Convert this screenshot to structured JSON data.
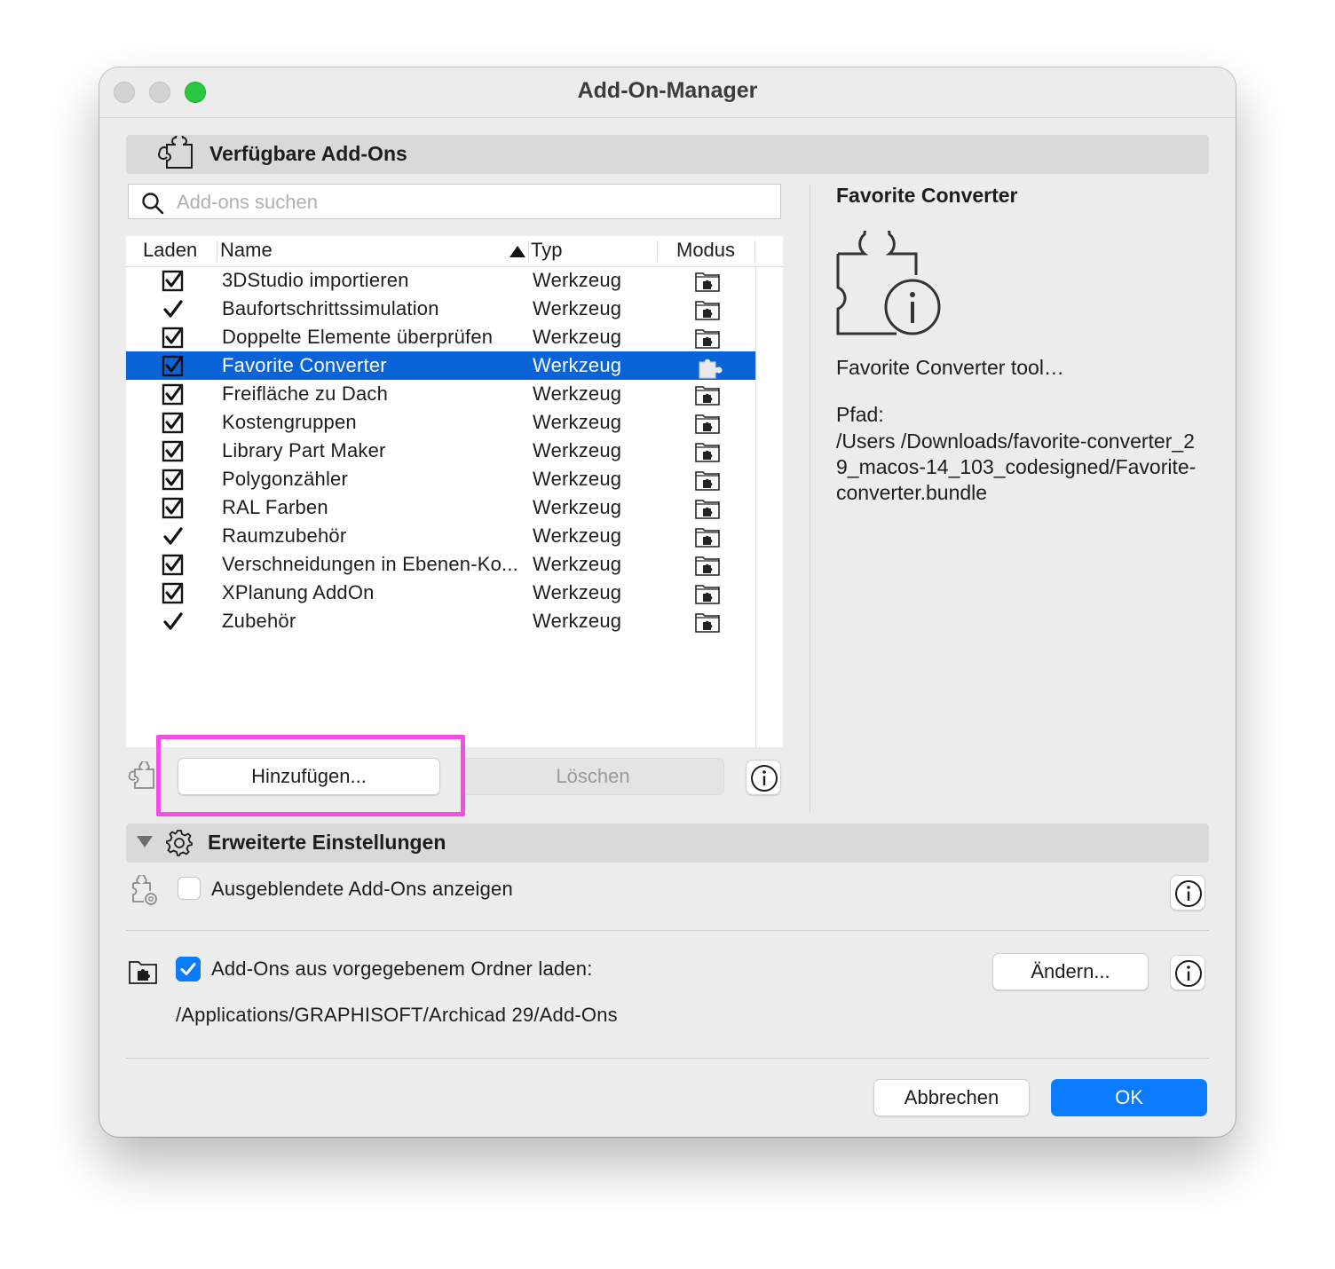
{
  "window": {
    "title": "Add-On-Manager"
  },
  "available": {
    "section_title": "Verfügbare Add-Ons",
    "search_placeholder": "Add-ons suchen",
    "columns": {
      "load": "Laden",
      "name": "Name",
      "type": "Typ",
      "mode": "Modus"
    },
    "rows": [
      {
        "name": "3DStudio importieren",
        "type": "Werkzeug",
        "load": "checkbox"
      },
      {
        "name": "Baufortschrittssimulation",
        "type": "Werkzeug",
        "load": "check"
      },
      {
        "name": "Doppelte Elemente überprüfen",
        "type": "Werkzeug",
        "load": "checkbox"
      },
      {
        "name": "Favorite Converter",
        "type": "Werkzeug",
        "load": "checkbox",
        "selected": true
      },
      {
        "name": "Freifläche zu Dach",
        "type": "Werkzeug",
        "load": "checkbox"
      },
      {
        "name": "Kostengruppen",
        "type": "Werkzeug",
        "load": "checkbox"
      },
      {
        "name": "Library Part Maker",
        "type": "Werkzeug",
        "load": "checkbox"
      },
      {
        "name": "Polygonzähler",
        "type": "Werkzeug",
        "load": "checkbox"
      },
      {
        "name": "RAL Farben",
        "type": "Werkzeug",
        "load": "checkbox"
      },
      {
        "name": "Raumzubehör",
        "type": "Werkzeug",
        "load": "check"
      },
      {
        "name": "Verschneidungen in Ebenen-Ko...",
        "type": "Werkzeug",
        "load": "checkbox"
      },
      {
        "name": "XPlanung AddOn",
        "type": "Werkzeug",
        "load": "checkbox"
      },
      {
        "name": "Zubehör",
        "type": "Werkzeug",
        "load": "check"
      }
    ],
    "add_button": "Hinzufügen...",
    "delete_button": "Löschen"
  },
  "detail": {
    "title": "Favorite Converter",
    "description": "Favorite Converter tool…",
    "path_label": "Pfad:",
    "path": "/Users /Downloads/favorite-converter_29_macos-14_103_codesigned/Favorite-converter.bundle"
  },
  "advanced": {
    "section_title": "Erweiterte Einstellungen",
    "show_hidden_label": "Ausgeblendete Add-Ons anzeigen",
    "show_hidden_checked": false,
    "load_folder_label": "Add-Ons aus vorgegebenem Ordner laden:",
    "load_folder_checked": true,
    "change_button": "Ändern...",
    "folder_path": "/Applications/GRAPHISOFT/Archicad 29/Add-Ons"
  },
  "footer": {
    "cancel_button": "Abbrechen",
    "ok_button": "OK"
  },
  "colors": {
    "accent": "#0a7aff",
    "selection": "#0a64d8",
    "highlight": "#f24de8"
  }
}
